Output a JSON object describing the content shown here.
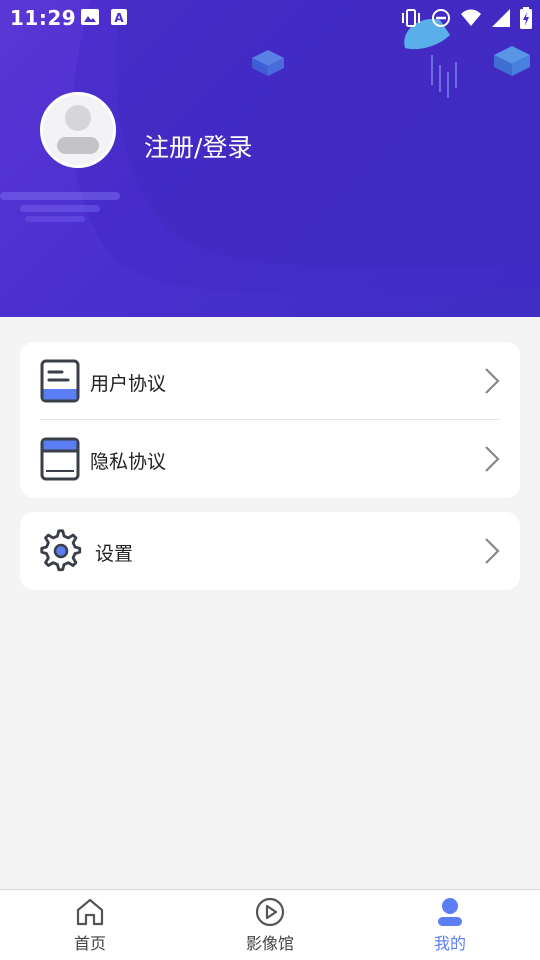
{
  "status_bar": {
    "time": "11:29",
    "left_icons": [
      "image-icon",
      "text-a-icon"
    ],
    "right_icons": [
      "vibrate-icon",
      "do-not-disturb-icon",
      "wifi-icon",
      "signal-icon",
      "battery-charging-icon"
    ]
  },
  "profile": {
    "avatar_icon": "default-avatar-icon",
    "login_label": "注册/登录"
  },
  "menu": {
    "group1": [
      {
        "icon": "document-icon",
        "label": "用户协议"
      },
      {
        "icon": "book-icon",
        "label": "隐私协议"
      }
    ],
    "group2": [
      {
        "icon": "gear-icon",
        "label": "设置"
      }
    ]
  },
  "tabbar": {
    "tabs": [
      {
        "icon": "home-icon",
        "label": "首页",
        "active": false
      },
      {
        "icon": "play-circle-icon",
        "label": "影像馆",
        "active": false
      },
      {
        "icon": "user-icon",
        "label": "我的",
        "active": true
      }
    ]
  },
  "colors": {
    "header_gradient_start": "#5a36d6",
    "header_gradient_end": "#3e2ec2",
    "accent": "#5b7ef5",
    "background": "#f4f4f4"
  }
}
